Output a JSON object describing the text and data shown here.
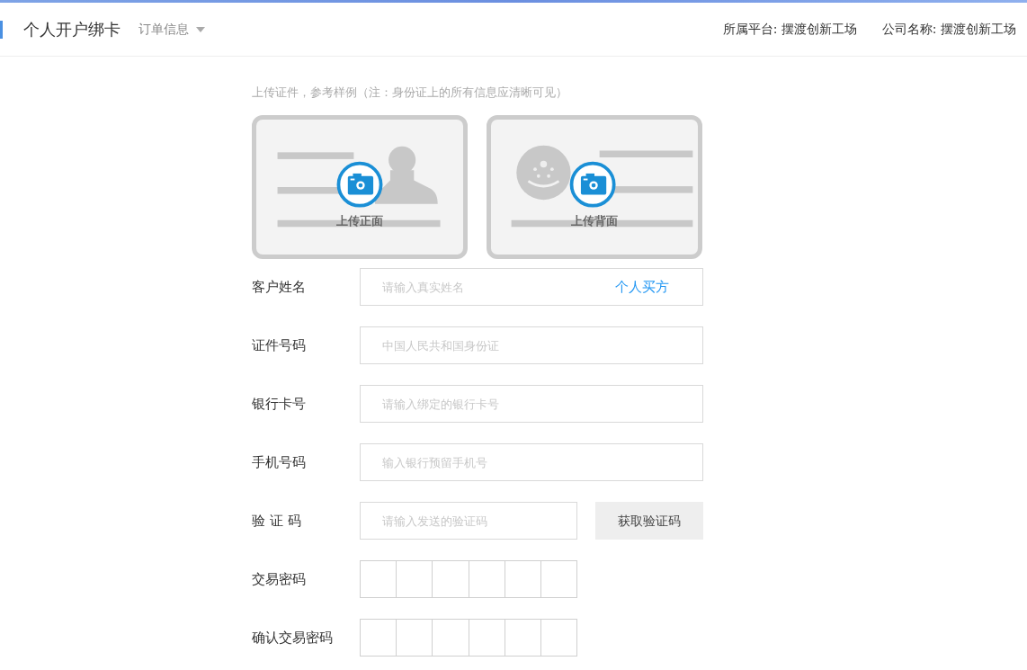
{
  "header": {
    "title": "个人开户绑卡",
    "menu": {
      "label": "订单信息"
    },
    "platform": "所属平台: 摆渡创新工场",
    "company": "公司名称: 摆渡创新工场"
  },
  "upload": {
    "hint": "上传证件，参考样例（注：身份证上的所有信息应清晰可见）",
    "cards": [
      {
        "kind": "front",
        "label": "上传正面"
      },
      {
        "kind": "back",
        "label": "上传背面"
      }
    ]
  },
  "fields": [
    {
      "kind": "tagged",
      "label": "客户姓名",
      "placeholder": "请输入真实姓名",
      "tag": "个人买方"
    },
    {
      "kind": "text",
      "label": "证件号码",
      "placeholder": "中国人民共和国身份证"
    },
    {
      "kind": "text",
      "label": "银行卡号",
      "placeholder": "请输入绑定的银行卡号"
    },
    {
      "kind": "text",
      "label": "手机号码",
      "placeholder": "输入银行预留手机号"
    },
    {
      "kind": "code",
      "label": "验 证 码",
      "placeholder": "请输入发送的验证码",
      "button": "获取验证码"
    },
    {
      "kind": "pin",
      "label": "交易密码"
    },
    {
      "kind": "pin",
      "label": "确认交易密码"
    }
  ]
}
